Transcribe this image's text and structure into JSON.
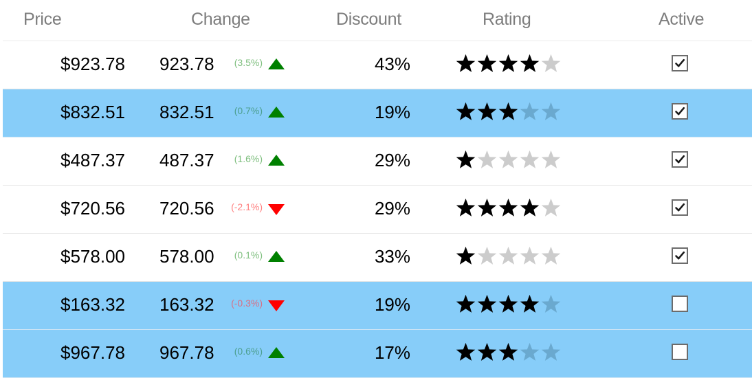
{
  "colors": {
    "selected_row": "#87cdf9",
    "up_arrow": "#008000",
    "down_arrow": "#ff0000",
    "star_filled": "#000000",
    "star_empty": "#cccccc",
    "star_empty_selected": "#6aa9cf",
    "header_text": "#7d7d7d"
  },
  "columns": {
    "price": "Price",
    "change": "Change",
    "discount": "Discount",
    "rating": "Rating",
    "active": "Active"
  },
  "rows": [
    {
      "price": "$923.78",
      "change_value": "923.78",
      "change_pct": "(3.5%)",
      "direction": "up",
      "discount": "43%",
      "rating": 4,
      "active": true,
      "selected": false
    },
    {
      "price": "$832.51",
      "change_value": "832.51",
      "change_pct": "(0.7%)",
      "direction": "up",
      "discount": "19%",
      "rating": 3,
      "active": true,
      "selected": true
    },
    {
      "price": "$487.37",
      "change_value": "487.37",
      "change_pct": "(1.6%)",
      "direction": "up",
      "discount": "29%",
      "rating": 1,
      "active": true,
      "selected": false
    },
    {
      "price": "$720.56",
      "change_value": "720.56",
      "change_pct": "(-2.1%)",
      "direction": "down",
      "discount": "29%",
      "rating": 4,
      "active": true,
      "selected": false
    },
    {
      "price": "$578.00",
      "change_value": "578.00",
      "change_pct": "(0.1%)",
      "direction": "up",
      "discount": "33%",
      "rating": 1,
      "active": true,
      "selected": false
    },
    {
      "price": "$163.32",
      "change_value": "163.32",
      "change_pct": "(-0.3%)",
      "direction": "down",
      "discount": "19%",
      "rating": 4,
      "active": false,
      "selected": true
    },
    {
      "price": "$967.78",
      "change_value": "967.78",
      "change_pct": "(0.6%)",
      "direction": "up",
      "discount": "17%",
      "rating": 3,
      "active": false,
      "selected": true
    }
  ],
  "rating_max": 5
}
